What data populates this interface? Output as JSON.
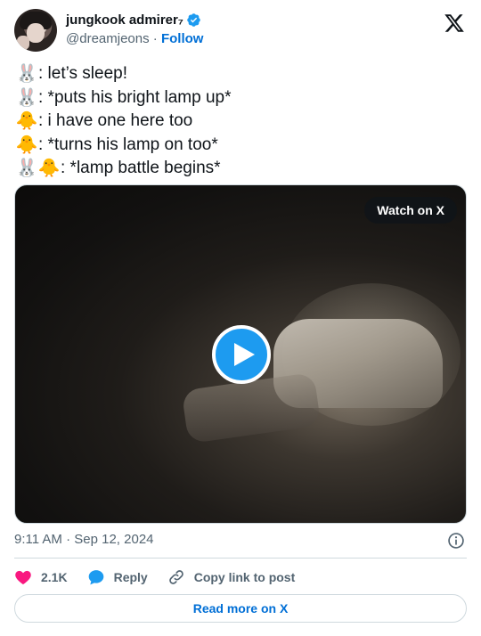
{
  "author": {
    "name": "jungkook admirer₇",
    "handle": "@dreamjeons",
    "separator": "·",
    "follow_label": "Follow"
  },
  "tweet": {
    "lines": [
      {
        "emojis": [
          "🐰"
        ],
        "text": ": let’s sleep!"
      },
      {
        "emojis": [
          "🐰"
        ],
        "text": ": *puts his bright lamp up*"
      },
      {
        "emojis": [
          "🐥"
        ],
        "text": ": i have one here too"
      },
      {
        "emojis": [
          "🐥"
        ],
        "text": ": *turns his lamp on too*"
      },
      {
        "emojis": [
          "🐰",
          "🐥"
        ],
        "text": ": *lamp battle begins*"
      }
    ]
  },
  "media": {
    "watch_label": "Watch on X",
    "play_icon": "play-icon"
  },
  "meta": {
    "time": "9:11 AM",
    "separator": "·",
    "date": "Sep 12, 2024"
  },
  "actions": {
    "likes": "2.1K",
    "reply_label": "Reply",
    "copy_label": "Copy link to post"
  },
  "read_more_label": "Read more on X",
  "colors": {
    "accent": "#1d9bf0",
    "link": "#006fd6",
    "heart": "#f91880",
    "muted": "#536471"
  }
}
